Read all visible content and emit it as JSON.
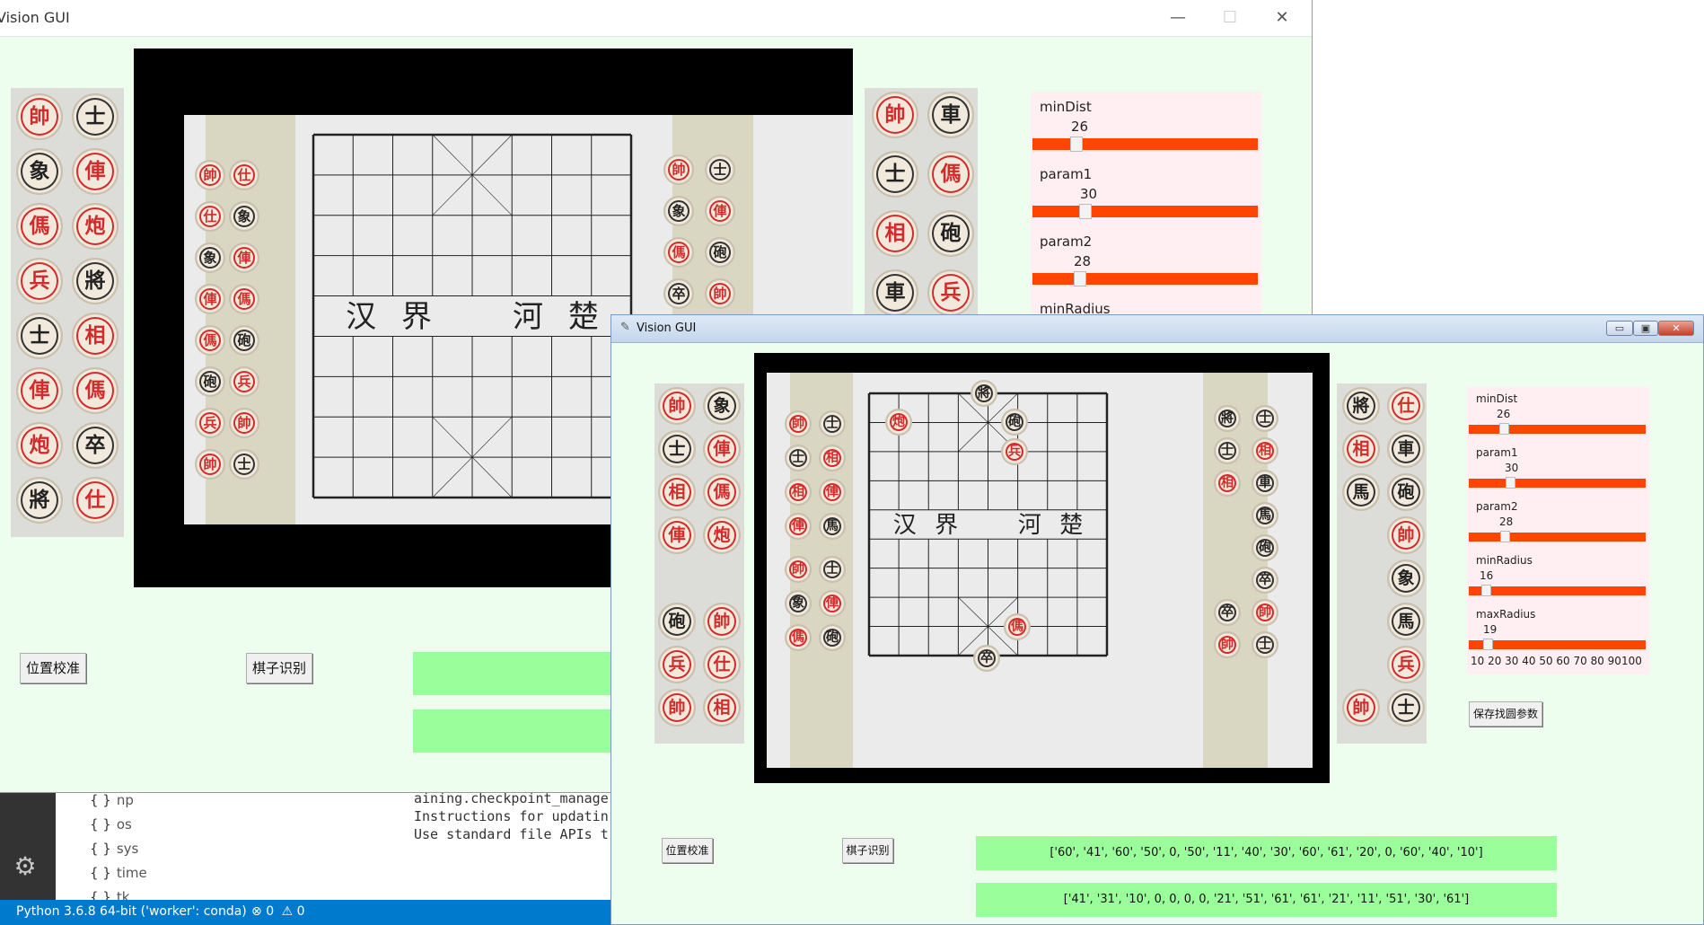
{
  "editor": {
    "outline_symbols": [
      {
        "icon": "{ }",
        "name": "np"
      },
      {
        "icon": "{ }",
        "name": "os"
      },
      {
        "icon": "{ }",
        "name": "sys"
      },
      {
        "icon": "{ }",
        "name": "time"
      },
      {
        "icon": "{ }",
        "name": "tk"
      }
    ],
    "terminal_lines": [
      "aining.checkpoint_manage",
      "Instructions for updatin",
      "Use standard file APIs t"
    ],
    "status": {
      "interpreter": "Python 3.6.8 64-bit ('worker': conda)",
      "errors_icon": "⊗",
      "errors": "0",
      "warnings_icon": "⚠",
      "warnings": "0"
    }
  },
  "win1": {
    "title": "Vision GUI",
    "controls": {
      "minimize": "—",
      "maximize": "☐",
      "close": "✕"
    },
    "sliders": [
      {
        "label": "minDist",
        "value": "26",
        "fraction": 0.26
      },
      {
        "label": "param1",
        "value": "30",
        "fraction": 0.3
      },
      {
        "label": "param2",
        "value": "28",
        "fraction": 0.28
      },
      {
        "label": "minRadius",
        "value": "",
        "fraction": 0.16
      }
    ],
    "buttons": {
      "calibrate": "位置校准",
      "recognize": "棋子识别"
    },
    "board_text": {
      "left": "汉",
      "left2": "界",
      "right": "河",
      "right2": "楚"
    }
  },
  "win2": {
    "title": "Vision GUI",
    "controls": {
      "minimize": "▭",
      "maximize": "▣",
      "close": "✕"
    },
    "sliders": [
      {
        "label": "minDist",
        "value": "26",
        "fraction": 0.26
      },
      {
        "label": "param1",
        "value": "30",
        "fraction": 0.3
      },
      {
        "label": "param2",
        "value": "28",
        "fraction": 0.28
      },
      {
        "label": "minRadius",
        "value": "16",
        "fraction": 0.16
      },
      {
        "label": "maxRadius",
        "value": "19",
        "fraction": 0.19
      }
    ],
    "scale_ticks": "10 20 30 40 50 60 70 80 90100",
    "buttons": {
      "calibrate": "位置校准",
      "recognize": "棋子识别",
      "save_params": "保存找圆参数"
    },
    "output1": "['60', '41', '60', '50', 0, '50', '11', '40', '30', '60', '61', '20', 0, '60', '40', '10']",
    "output2": "['41', '31', '10', 0, 0, 0, 0, '21', '51', '61', '61', '21', '11', '51', '30', '61']",
    "board_text": {
      "left": "汉",
      "left2": "界",
      "right": "河",
      "right2": "楚"
    }
  },
  "pieces": {
    "red": [
      "帥",
      "仕",
      "相",
      "俥",
      "傌",
      "炮",
      "兵"
    ],
    "black": [
      "將",
      "士",
      "象",
      "車",
      "馬",
      "砲",
      "卒"
    ]
  },
  "colors": {
    "window_bg": "#eefeee",
    "slider_bg": "#ffeef2",
    "slider_track": "#ff4500",
    "output_bg": "#9afe9a",
    "status_bar": "#007acc"
  }
}
